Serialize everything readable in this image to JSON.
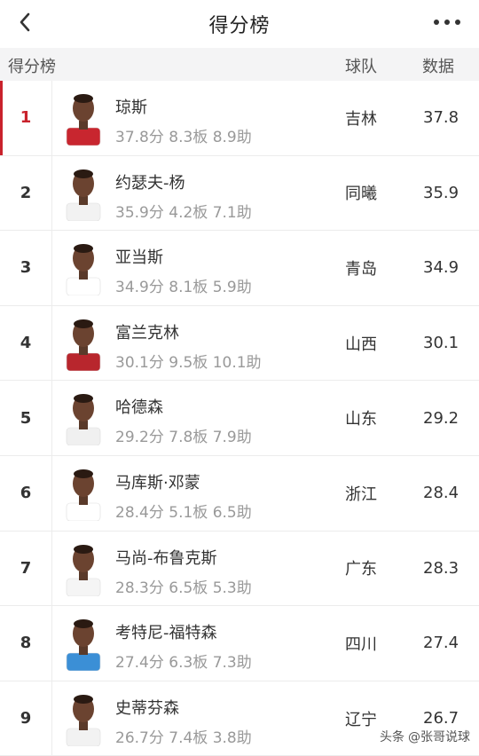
{
  "nav": {
    "title": "得分榜"
  },
  "header": {
    "label": "得分榜",
    "team": "球队",
    "data": "数据"
  },
  "rows": [
    {
      "rank": "1",
      "name": "琼斯",
      "stats": "37.8分 8.3板 8.9助",
      "team": "吉林",
      "value": "37.8",
      "jersey": "#c8262f"
    },
    {
      "rank": "2",
      "name": "约瑟夫-杨",
      "stats": "35.9分 4.2板 7.1助",
      "team": "同曦",
      "value": "35.9",
      "jersey": "#f2f2f2"
    },
    {
      "rank": "3",
      "name": "亚当斯",
      "stats": "34.9分 8.1板 5.9助",
      "team": "青岛",
      "value": "34.9",
      "jersey": "#ffffff"
    },
    {
      "rank": "4",
      "name": "富兰克林",
      "stats": "30.1分 9.5板 10.1助",
      "team": "山西",
      "value": "30.1",
      "jersey": "#b8262d"
    },
    {
      "rank": "5",
      "name": "哈德森",
      "stats": "29.2分 7.8板 7.9助",
      "team": "山东",
      "value": "29.2",
      "jersey": "#f0f0f0"
    },
    {
      "rank": "6",
      "name": "马库斯·邓蒙",
      "stats": "28.4分 5.1板 6.5助",
      "team": "浙江",
      "value": "28.4",
      "jersey": "#ffffff"
    },
    {
      "rank": "7",
      "name": "马尚-布鲁克斯",
      "stats": "28.3分 6.5板 5.3助",
      "team": "广东",
      "value": "28.3",
      "jersey": "#f5f5f5"
    },
    {
      "rank": "8",
      "name": "考特尼-福特森",
      "stats": "27.4分 6.3板 7.3助",
      "team": "四川",
      "value": "27.4",
      "jersey": "#3b8fd6"
    },
    {
      "rank": "9",
      "name": "史蒂芬森",
      "stats": "26.7分 7.4板 3.8助",
      "team": "辽宁",
      "value": "26.7",
      "jersey": "#f2f2f2"
    }
  ],
  "watermark": {
    "prefix": "头条",
    "handle": "@张哥说球"
  }
}
